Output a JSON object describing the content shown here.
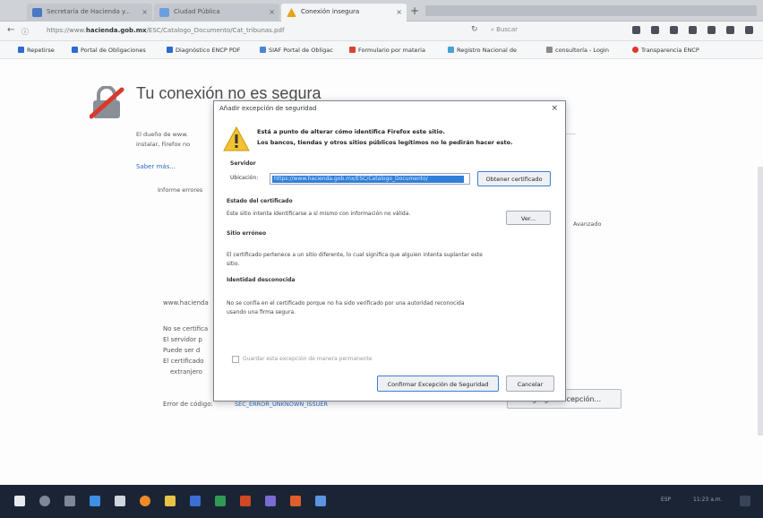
{
  "browser": {
    "tabs": [
      {
        "label": "Secretaría de Hacienda y...",
        "active": false
      },
      {
        "label": "Ciudad Pública",
        "active": false
      },
      {
        "label": "Conexión insegura",
        "active": true
      }
    ],
    "new_tab": "+",
    "url_prefix": "https://www.",
    "url_domain": "hacienda.gob.mx",
    "url_rest": "/ESC/Catalogo_Documento/Cat_tribunas.pdf",
    "search_placeholder": "Buscar",
    "bookmarks": [
      {
        "label": "Repetirse",
        "color": "#2e6ad1"
      },
      {
        "label": "Portal de Obligaciones",
        "color": "#2e6ad1"
      },
      {
        "label": "Diagnóstico ENCP PDF",
        "color": "#2e6ad1"
      },
      {
        "label": "SIAF Portal de Obligac",
        "color": "#4a86d8"
      },
      {
        "label": "Formulario por materia",
        "color": "#d94433"
      },
      {
        "label": "Registro Nacional de",
        "color": "#4aa1d8"
      },
      {
        "label": "consultoría - Login",
        "color": "#8a8a8a"
      },
      {
        "label": "Transparencia ENCP",
        "color": "#d93a2e"
      }
    ]
  },
  "page": {
    "title": "Tu conexión no es segura",
    "para1_line1": "El dueño de www.",
    "para1_line2": "instalar, Firefox no",
    "learn_more": "Saber más...",
    "info_line": "Informe errores",
    "advanced_label": "Avanzado",
    "host_line": "www.hacienda",
    "detail_lines": [
      "No se certifica",
      "El servidor p",
      "Puede ser d",
      "El certificado",
      "extranjero"
    ],
    "error_code_label": "Error de código:",
    "error_code": "SEC_ERROR_UNKNOWN_ISSUER",
    "add_exception": "Agregar excepción..."
  },
  "dialog": {
    "title": "Añadir excepción de seguridad",
    "close": "×",
    "warning_line1": "Está a punto de alterar cómo identifica Firefox este sitio.",
    "warning_line2": "Los bancos, tiendas y otros sitios públicos legítimos no le pedirán hacer esto.",
    "server_section": "Servidor",
    "location_label": "Ubicación:",
    "location_value": "https://www.hacienda.gob.mx/ESC/Catalogo_Documento/",
    "get_cert_button": "Obtener certificado",
    "status_section": "Estado del certificado",
    "status_text": "Este sitio intenta identificarse a sí mismo con información no válida.",
    "view_button": "Ver...",
    "site_label": "Sitio erróneo",
    "cert_text1": "El certificado pertenece a un sitio diferente, lo cual significa que alguien intenta suplantar este",
    "cert_text2": "sitio.",
    "identity_label": "Identidad desconocida",
    "identity_text1": "No se confía en el certificado porque no ha sido verificado por una autoridad reconocida",
    "identity_text2": "usando una firma segura.",
    "permanent_checkbox": "Guardar esta excepción de manera permanente",
    "confirm_button": "Confirmar Excepción de Seguridad",
    "cancel_button": "Cancelar"
  },
  "taskbar": {
    "tray_text": "ESP",
    "clock": "11:23 a.m."
  }
}
